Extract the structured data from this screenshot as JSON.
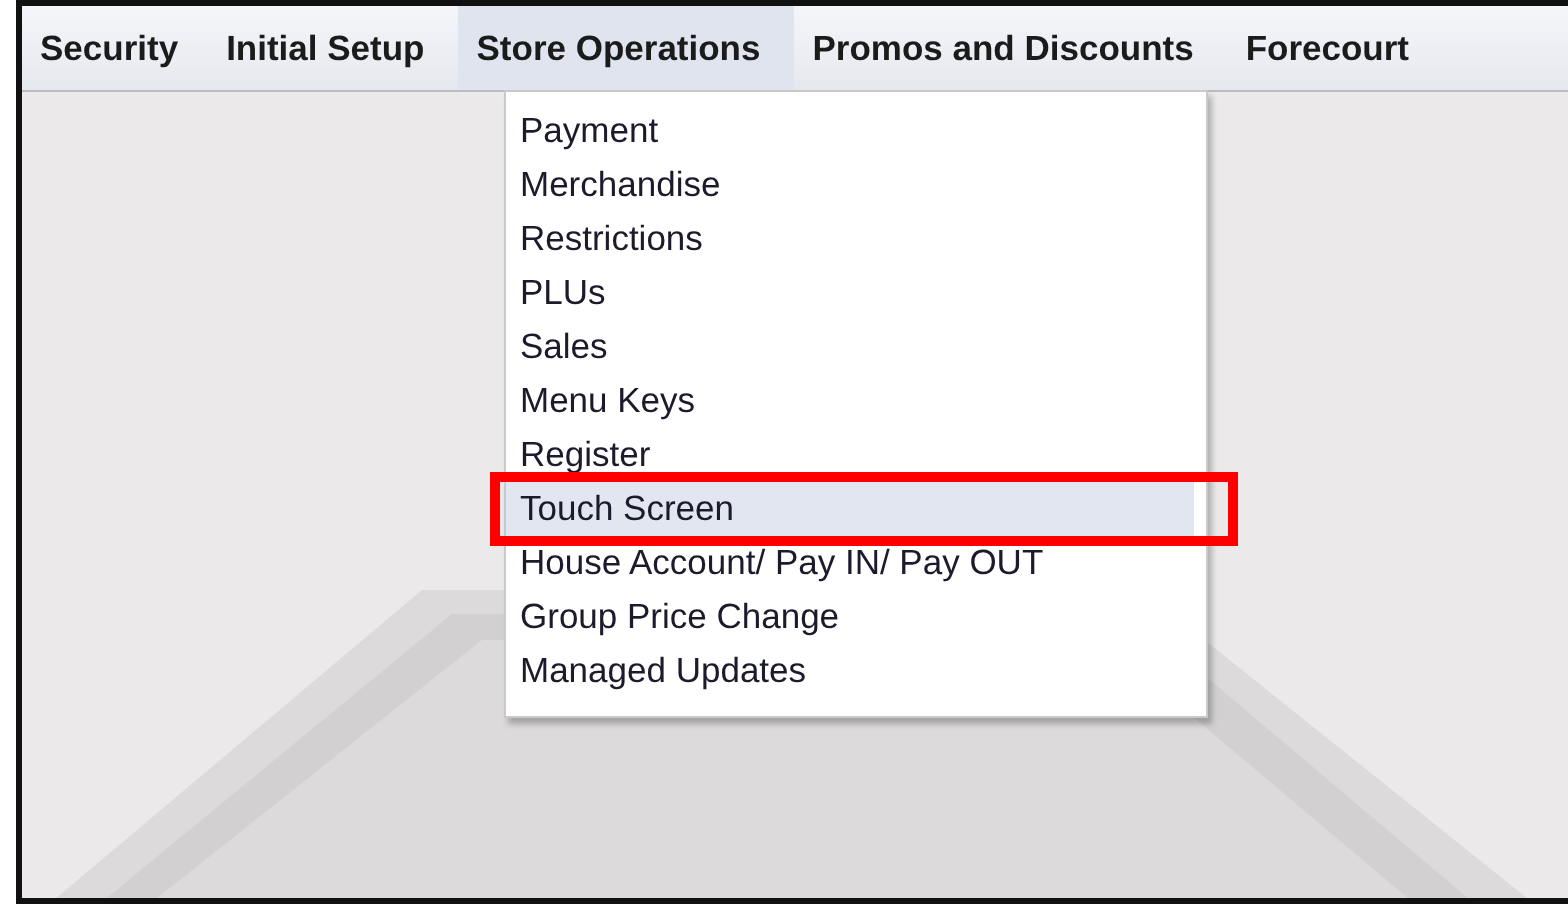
{
  "menu_bar": [
    {
      "label": "Security",
      "selected": false
    },
    {
      "label": "Initial Setup",
      "selected": false
    },
    {
      "label": "Store Operations",
      "selected": true
    },
    {
      "label": "Promos and Discounts",
      "selected": false
    },
    {
      "label": "Forecourt",
      "selected": false
    }
  ],
  "dropdown": {
    "items": [
      {
        "label": "Payment",
        "selected": false,
        "outlined": false
      },
      {
        "label": "Merchandise",
        "selected": false,
        "outlined": false
      },
      {
        "label": "Restrictions",
        "selected": false,
        "outlined": false
      },
      {
        "label": "PLUs",
        "selected": false,
        "outlined": false
      },
      {
        "label": "Sales",
        "selected": false,
        "outlined": false
      },
      {
        "label": "Menu Keys",
        "selected": false,
        "outlined": false
      },
      {
        "label": "Register",
        "selected": false,
        "outlined": false
      },
      {
        "label": "Touch Screen",
        "selected": true,
        "outlined": true
      },
      {
        "label": "House Account/ Pay IN/ Pay OUT",
        "selected": false,
        "outlined": false
      },
      {
        "label": "Group Price Change",
        "selected": false,
        "outlined": false
      },
      {
        "label": "Managed Updates",
        "selected": false,
        "outlined": false
      }
    ]
  }
}
